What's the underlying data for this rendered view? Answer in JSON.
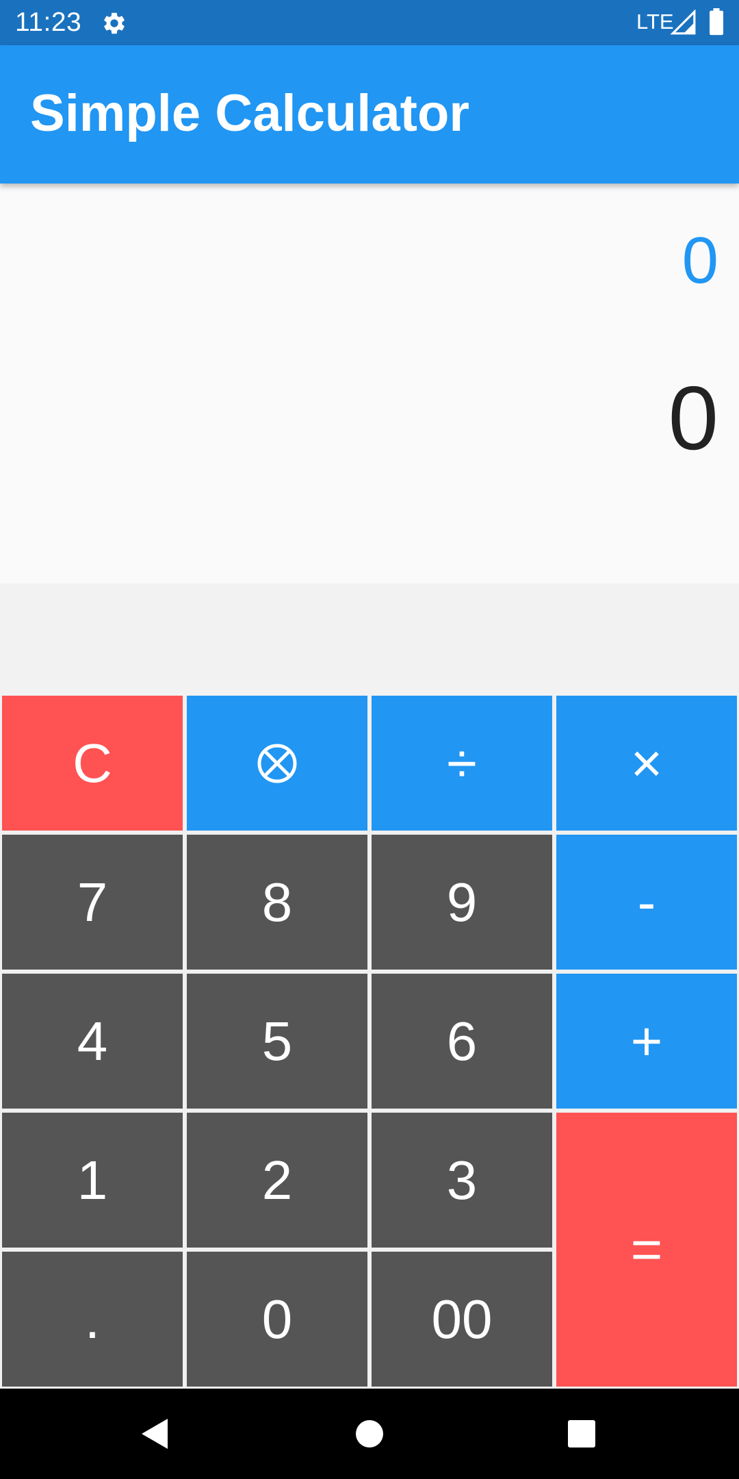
{
  "status_bar": {
    "time": "11:23",
    "network": "LTE",
    "icons": [
      "gear-icon",
      "signal-icon",
      "battery-icon"
    ]
  },
  "app_bar": {
    "title": "Simple Calculator"
  },
  "display": {
    "expression": "0",
    "result": "0"
  },
  "keypad": {
    "clear": "C",
    "backspace_icon": "circled-times-icon",
    "divide": "÷",
    "multiply": "×",
    "seven": "7",
    "eight": "8",
    "nine": "9",
    "minus": "-",
    "four": "4",
    "five": "5",
    "six": "6",
    "plus": "+",
    "one": "1",
    "two": "2",
    "three": "3",
    "equals": "=",
    "decimal": ".",
    "zero": "0",
    "double_zero": "00"
  },
  "nav_bar": {
    "icons": [
      "back-icon",
      "home-icon",
      "recents-icon"
    ]
  },
  "colors": {
    "status_bar": "#1a72bf",
    "app_bar": "#2196f3",
    "operator_key": "#2196f3",
    "accent_key": "#ff5252",
    "number_key": "#555555",
    "expression_text": "#2196f3",
    "result_text": "#222222"
  }
}
